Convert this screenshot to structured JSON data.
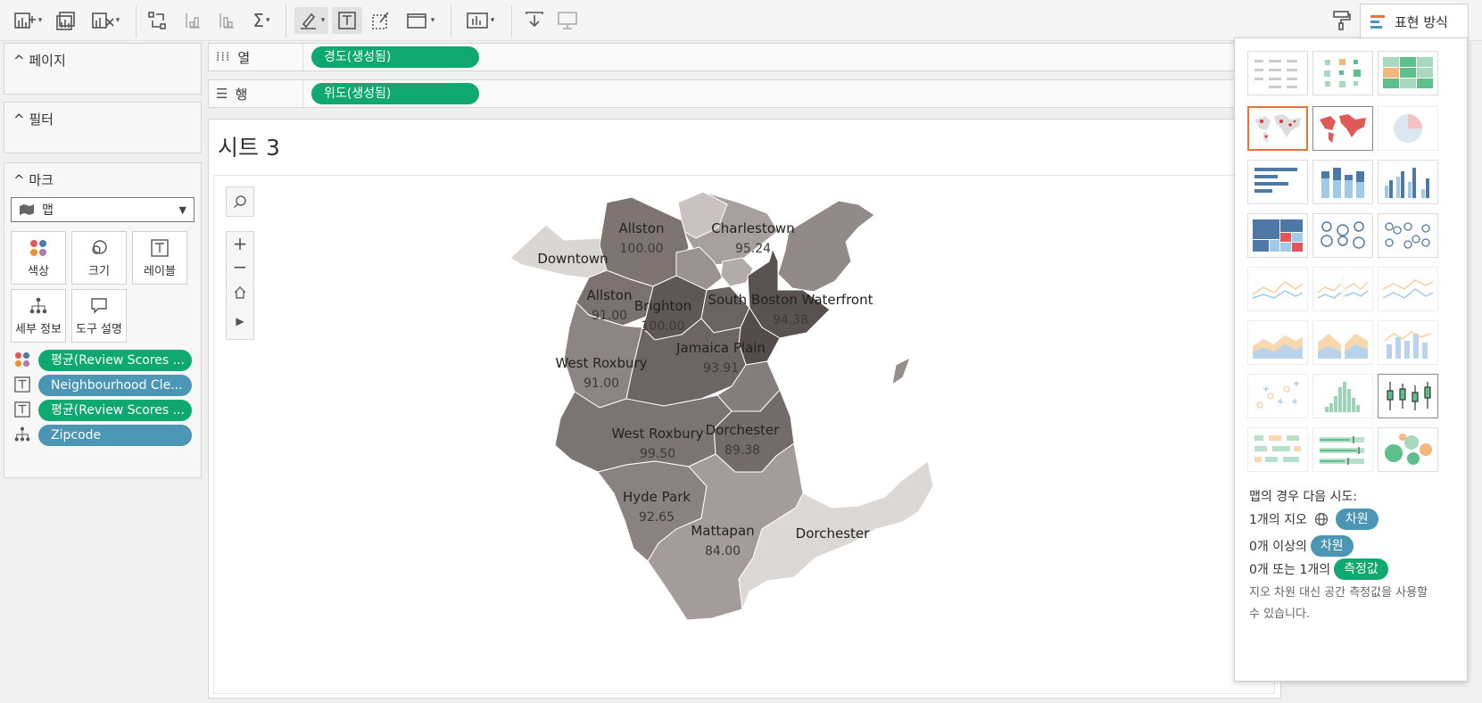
{
  "toolbar": {
    "show_me_label": "표현 방식"
  },
  "left": {
    "pages_title": "페이지",
    "filters_title": "필터",
    "marks_title": "마크",
    "mark_type": "맵",
    "mark_buttons": {
      "color": "색상",
      "size": "크기",
      "label": "레이블",
      "detail": "세부 정보",
      "tooltip": "도구 설명"
    },
    "mark_fields": [
      {
        "icon": "color-icon",
        "text": "평균(Review Scores ...",
        "color": "#0ea870"
      },
      {
        "icon": "label-icon",
        "text": "Neighbourhood Cle...",
        "color": "#4b95b5"
      },
      {
        "icon": "label-icon",
        "text": "평균(Review Scores ...",
        "color": "#0ea870"
      },
      {
        "icon": "detail-icon",
        "text": "Zipcode",
        "color": "#4b95b5"
      }
    ]
  },
  "shelves": {
    "columns_label": "열",
    "columns_pill": "경도(생성됨)",
    "rows_label": "행",
    "rows_pill": "위도(생성됨)"
  },
  "sheet": {
    "title": "시트 3"
  },
  "map_labels": [
    {
      "name": "Allston",
      "value": "100.00"
    },
    {
      "name": "Charlestown",
      "value": "95.24"
    },
    {
      "name": "Downtown",
      "value": ""
    },
    {
      "name": "Allston",
      "value": "91.00"
    },
    {
      "name": "Brighton",
      "value": "100.00"
    },
    {
      "name": "South Boston Waterfront",
      "value": "94.38"
    },
    {
      "name": "Jamaica Plain",
      "value": "93.91"
    },
    {
      "name": "West Roxbury",
      "value": "91.00"
    },
    {
      "name": "West Roxbury",
      "value": "99.50"
    },
    {
      "name": "Dorchester",
      "value": "89.38"
    },
    {
      "name": "Hyde Park",
      "value": "92.65"
    },
    {
      "name": "Mattapan",
      "value": "84.00"
    },
    {
      "name": "Dorchester",
      "value": ""
    }
  ],
  "show_me": {
    "hint_title": "맵의 경우 다음 시도:",
    "hint1_text": "1개의 지오",
    "hint1_pill": "차원",
    "hint2_text": "0개 이상의",
    "hint2_pill": "차원",
    "hint3_text": "0개 또는 1개의",
    "hint3_pill": "측정값",
    "hint_note_line1": "지오 차원 대신 공간 측정값을 사용할",
    "hint_note_line2": "수 있습니다.",
    "accent_color": "#e8743b"
  }
}
